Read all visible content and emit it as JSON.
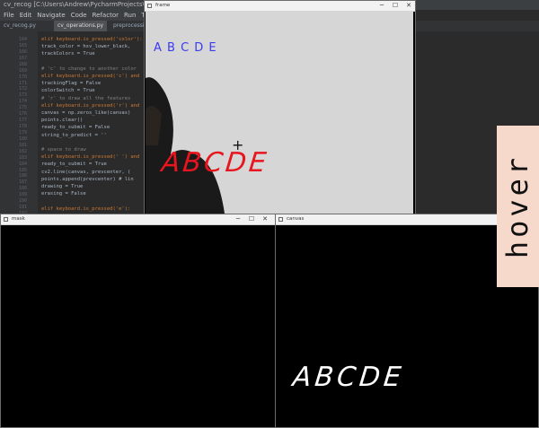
{
  "ide": {
    "title": "cv_recog [C:\\Users\\Andrew\\PycharmProjects\\cv_recog] - ...\\cv_recog.py - PyCharm",
    "menu": [
      "File",
      "Edit",
      "Navigate",
      "Code",
      "Refactor",
      "Run",
      "Tools",
      "VCS"
    ],
    "tabs": [
      "cv_recog.py",
      "cv_operations.py",
      "preprocessing.py"
    ],
    "line_numbers": [
      "164",
      "165",
      "166",
      "167",
      "168",
      "169",
      "170",
      "171",
      "172",
      "173",
      "174",
      "175",
      "176",
      "177",
      "178",
      "179",
      "180",
      "181",
      "182",
      "183",
      "184",
      "185",
      "186",
      "187",
      "188",
      "189",
      "190",
      "191",
      "192",
      "193",
      "194"
    ],
    "code_lines": [
      {
        "text": "elif keyboard.is_pressed('color'):",
        "cls": "kw"
      },
      {
        "text": "    track_color = hsv_lower_black,",
        "cls": ""
      },
      {
        "text": "    trackColors = True",
        "cls": ""
      },
      {
        "text": "",
        "cls": ""
      },
      {
        "text": "# 'c' to change to another color",
        "cls": "cmt"
      },
      {
        "text": "elif keyboard.is_pressed('c') and",
        "cls": "kw"
      },
      {
        "text": "    trackingFlag = False",
        "cls": ""
      },
      {
        "text": "    colorSwitch = True",
        "cls": ""
      },
      {
        "text": "# 'r' to draw all the features",
        "cls": "cmt"
      },
      {
        "text": "elif keyboard.is_pressed('r') and",
        "cls": "kw"
      },
      {
        "text": "    canvas = np.zeros_like(canvas)",
        "cls": ""
      },
      {
        "text": "    points.clear()",
        "cls": ""
      },
      {
        "text": "    ready_to_submit = False",
        "cls": ""
      },
      {
        "text": "    string_to_predict = ''",
        "cls": ""
      },
      {
        "text": "",
        "cls": ""
      },
      {
        "text": "# space to draw",
        "cls": "cmt"
      },
      {
        "text": "elif keyboard.is_pressed(' ') and",
        "cls": "kw"
      },
      {
        "text": "    ready_to_submit = True",
        "cls": ""
      },
      {
        "text": "    cv2.line(canvas, prevcenter, (",
        "cls": ""
      },
      {
        "text": "    points.append(prevcenter)  # lin",
        "cls": ""
      },
      {
        "text": "    drawing = True",
        "cls": ""
      },
      {
        "text": "    erasing = False",
        "cls": ""
      },
      {
        "text": "",
        "cls": ""
      },
      {
        "text": "elif keyboard.is_pressed('e'):",
        "cls": "kw"
      },
      {
        "text": "    drawing = False",
        "cls": ""
      }
    ]
  },
  "frame_window": {
    "title": "frame",
    "buttons": {
      "minimize": "─",
      "maximize": "☐",
      "close": "✕"
    },
    "blue_text": "A B C D E",
    "red_text": "ABCDE",
    "cursor": "+"
  },
  "mask_window": {
    "title": "mask",
    "buttons": {
      "minimize": "─",
      "maximize": "☐",
      "close": "✕"
    }
  },
  "canvas_window": {
    "title": "canvas",
    "text": "ABCDE"
  },
  "overlay": {
    "label": "hover"
  },
  "colors": {
    "ide_bg": "#2b2b2b",
    "frame_blue": "#3a3af0",
    "frame_red": "#e8141e",
    "canvas_text": "#ffffff",
    "hover_bg": "#f7d9cc"
  },
  "icons": [
    "window-app-icon",
    "minimize-icon",
    "maximize-icon",
    "close-icon",
    "crosshair-cursor-icon"
  ]
}
